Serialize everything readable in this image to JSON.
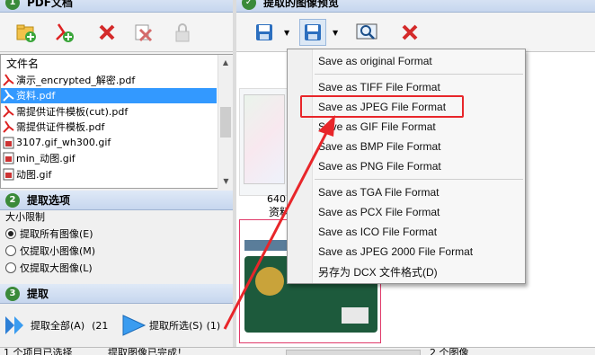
{
  "left_panel": {
    "top_header": {
      "num": "1",
      "title": "PDF文档"
    },
    "file_list": {
      "column_header": "文件名",
      "items": [
        {
          "name": "演示_encrypted_解密.pdf",
          "type": "pdf"
        },
        {
          "name": "资料.pdf",
          "type": "pdf",
          "selected": true
        },
        {
          "name": "需提供证件模板(cut).pdf",
          "type": "pdf"
        },
        {
          "name": "需提供证件模板.pdf",
          "type": "pdf"
        },
        {
          "name": "3107.gif_wh300.gif",
          "type": "image"
        },
        {
          "name": "min_动图.gif",
          "type": "image"
        },
        {
          "name": "动图.gif",
          "type": "image"
        }
      ]
    },
    "extract_options": {
      "num": "2",
      "title": "提取选项",
      "size_limit_label": "大小限制",
      "options": [
        {
          "label": "提取所有图像(E)",
          "checked": true
        },
        {
          "label": "仅提取小图像(M)",
          "checked": false
        },
        {
          "label": "仅提取大图像(L)",
          "checked": false
        }
      ]
    },
    "extract": {
      "num": "3",
      "title": "提取",
      "extract_all_label": "提取全部(A)",
      "extract_all_count": "(21",
      "extract_selected_label": "提取所选(S)",
      "extract_selected_count": "(1)"
    }
  },
  "right_panel": {
    "header": {
      "title": "提取的图像预览"
    },
    "thumbnails": [
      {
        "caption_size": "640",
        "caption_name": "资料"
      }
    ]
  },
  "save_menu": {
    "items": [
      "Save as original Format",
      "Save as TIFF File Format",
      "Save as JPEG File Format",
      "Save as GIF File Format",
      "Save as BMP File Format",
      "Save as PNG File Format",
      "Save as TGA File Format",
      "Save as PCX File Format",
      "Save as ICO File Format",
      "Save as JPEG 2000 File Format",
      "另存为 DCX 文件格式(D)"
    ],
    "highlighted_index": 2
  },
  "status_bar": {
    "left": "1 个项目已选择",
    "middle": "提取图像已完成！",
    "right": "2 个图像"
  },
  "colors": {
    "highlight_red": "#e8262a",
    "selection_blue": "#3399ff",
    "header_gradient_top": "#dfe9f7"
  }
}
